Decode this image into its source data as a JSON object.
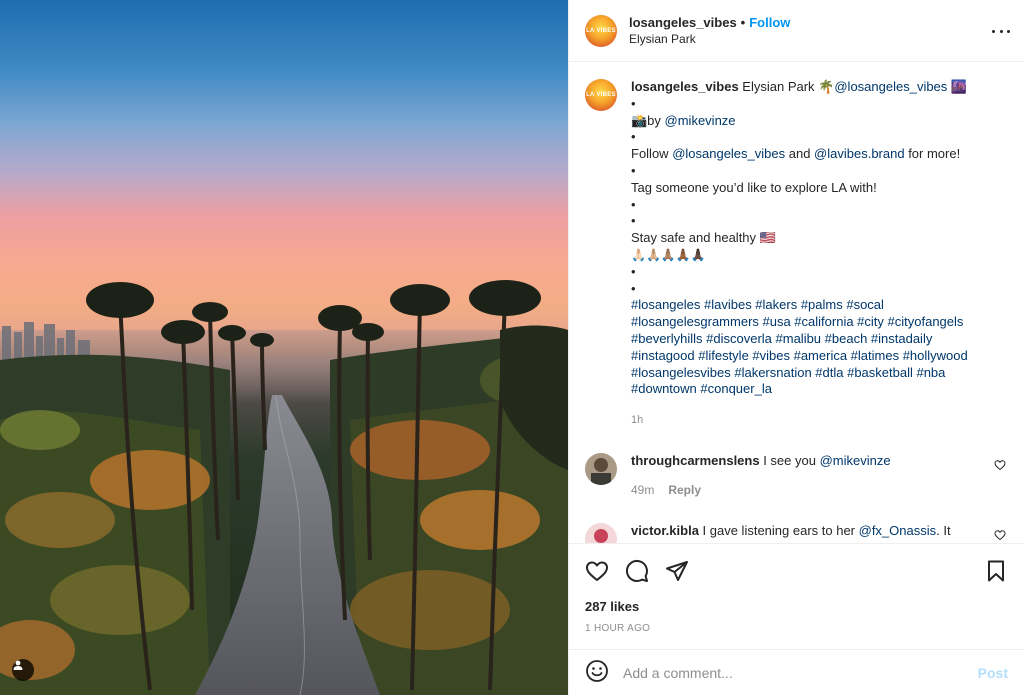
{
  "post": {
    "username": "losangeles_vibes",
    "follow_label": "Follow",
    "separator": "•",
    "location": "Elysian Park",
    "avatar_text": "LA VIBES"
  },
  "caption": {
    "username": "losangeles_vibes",
    "intro_text": "Elysian Park 🌴",
    "intro_mention": "@losangeles_vibes",
    "intro_emoji": "🌆",
    "bullet": "•",
    "photo_prefix": "📸by ",
    "photo_mention": "@mikevinze",
    "follow_text_1": "Follow ",
    "follow_mention_1": "@losangeles_vibes",
    "follow_text_2": " and ",
    "follow_mention_2": "@lavibes.brand",
    "follow_text_3": " for more!",
    "tag_text": "Tag someone you’d like to explore LA with!",
    "safe_text": "Stay safe and healthy 🇺🇸",
    "hands": "🙏🏻🙏🏼🙏🏽🙏🏾🙏🏿",
    "hashtags": [
      "#losangeles #lavibes #lakers #palms #socal",
      "#losangelesgrammers #usa #california #city #cityofangels",
      "#beverlyhills #discoverla #malibu #beach #instadaily",
      "#instagood #lifestyle #vibes #america #latimes #hollywood",
      "#losangelesvibes #lakersnation #dtla #basketball #nba",
      "#downtown #conquer_la"
    ],
    "time": "1h"
  },
  "comments": [
    {
      "username": "throughcarmenslens",
      "text": " I see you ",
      "mention": "@mikevinze",
      "time": "49m",
      "reply_label": "Reply"
    },
    {
      "username": "victor.kibla",
      "text": " I gave listening ears to her ",
      "mention": "@fx_Onassis",
      "text_after": ". It",
      "time": "",
      "reply_label": ""
    }
  ],
  "actions": {
    "likes": "287 likes",
    "ago": "1 HOUR AGO",
    "comment_placeholder": "Add a comment...",
    "post_label": "Post"
  },
  "icons": {
    "more": "more-options-icon",
    "like": "heart-icon",
    "comment": "comment-icon",
    "share": "share-icon",
    "save": "bookmark-icon",
    "emoji": "emoji-icon",
    "user_tag": "user-tag-icon"
  },
  "colors": {
    "link": "#00376b",
    "follow": "#0095f6",
    "muted": "#8e8e8e",
    "post_disabled": "#b2dffc"
  }
}
